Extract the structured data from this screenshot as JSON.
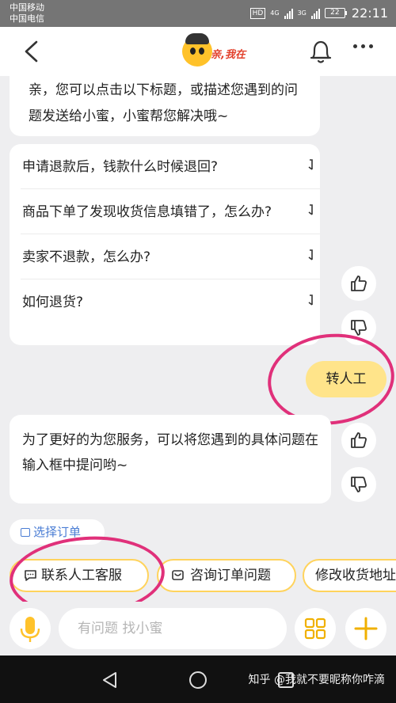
{
  "status_bar": {
    "carrier_1": "中国移动",
    "carrier_2": "中国电信",
    "hd": "HD",
    "net_1": "4G",
    "net_2": "3G",
    "battery": "22",
    "time": "22:11"
  },
  "header": {
    "logo_text": "亲,我在"
  },
  "chat": {
    "intro": "亲，您可以点击以下标题，或描述您遇到的问题发送给小蜜，小蜜帮您解决哦~",
    "faq": [
      "申请退款后，钱款什么时候退回?",
      "商品下单了发现收货信息填错了，怎么办?",
      "卖家不退款，怎么办?",
      "如何退货?"
    ],
    "user_message": "转人工",
    "reply": "为了更好的为您服务，可以将您遇到的具体问题在输入框中提问哟~"
  },
  "order_chip": "选择订单",
  "quick_actions": [
    "联系人工客服",
    "咨询订单问题",
    "修改收货地址"
  ],
  "input": {
    "placeholder": "有问题 找小蜜"
  },
  "watermark": "知乎 @我就不要昵称你咋滴",
  "colors": {
    "accent": "#ffc22a",
    "annotation": "#e0307a",
    "user_bubble": "#ffe48a"
  }
}
